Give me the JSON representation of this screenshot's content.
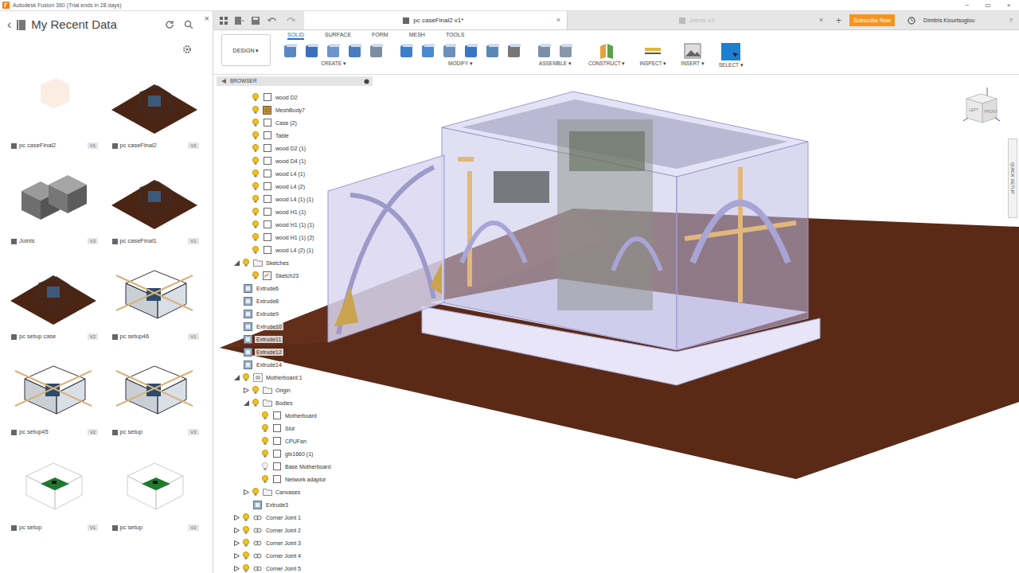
{
  "window": {
    "title": "Autodesk Fusion 360 (Trial ends in 28 days)",
    "controls": [
      "−",
      "▭",
      "×"
    ]
  },
  "data_panel": {
    "back": "‹",
    "title": "My Recent Data",
    "close": "×",
    "items": [
      {
        "name": "pc caseFinal2",
        "version": "V1",
        "kind": "blank"
      },
      {
        "name": "pc caseFinal2",
        "version": "V2",
        "kind": "floor"
      },
      {
        "name": "Joints",
        "version": "V3",
        "kind": "joints"
      },
      {
        "name": "pc caseFinal1",
        "version": "V1",
        "kind": "floor"
      },
      {
        "name": "pc setup case",
        "version": "V2",
        "kind": "floor"
      },
      {
        "name": "pc setup46",
        "version": "V1",
        "kind": "box"
      },
      {
        "name": "pc setup45",
        "version": "V2",
        "kind": "box"
      },
      {
        "name": "pc setup",
        "version": "V3",
        "kind": "box"
      },
      {
        "name": "pc setup",
        "version": "V1",
        "kind": "board"
      },
      {
        "name": "pc setup",
        "version": "V2",
        "kind": "board"
      }
    ]
  },
  "document_tabs": [
    {
      "label": "pc caseFinal2 v1*",
      "selected": true,
      "close": "×"
    },
    {
      "label": "Joints v3",
      "selected": false,
      "close": "×"
    }
  ],
  "new_tab": "+",
  "subscribe": "Subscribe Now",
  "user": "Dimitris Kiourtsoglou",
  "help": "?",
  "workspace": "DESIGN ▾",
  "toolbar_tabs": [
    {
      "label": "SOLID",
      "selected": true
    },
    {
      "label": "SURFACE",
      "selected": false
    },
    {
      "label": "FORM",
      "selected": false
    },
    {
      "label": "MESH",
      "selected": false
    },
    {
      "label": "TOOLS",
      "selected": false
    }
  ],
  "toolbar_groups": [
    {
      "label": "CREATE ▾"
    },
    {
      "label": "MODIFY ▾"
    },
    {
      "label": "ASSEMBLE ▾"
    },
    {
      "label": "CONSTRUCT ▾"
    },
    {
      "label": "INSPECT ▾"
    },
    {
      "label": "INSERT ▾"
    },
    {
      "label": "SELECT ▾"
    }
  ],
  "browser": {
    "title": "BROWSER",
    "rows": [
      {
        "label": "wood D2",
        "level": 1,
        "kind": "body",
        "visible": true
      },
      {
        "label": "MeshBody7",
        "level": 1,
        "kind": "mesh",
        "visible": true
      },
      {
        "label": "Case (2)",
        "level": 1,
        "kind": "body",
        "visible": true
      },
      {
        "label": "Table",
        "level": 1,
        "kind": "body",
        "visible": true
      },
      {
        "label": "wood D2 (1)",
        "level": 1,
        "kind": "body",
        "visible": true
      },
      {
        "label": "wood D4 (1)",
        "level": 1,
        "kind": "body",
        "visible": true
      },
      {
        "label": "wood L4 (1)",
        "level": 1,
        "kind": "body",
        "visible": true
      },
      {
        "label": "wood L4 (2)",
        "level": 1,
        "kind": "body",
        "visible": true
      },
      {
        "label": "wood L4 (1) (1)",
        "level": 1,
        "kind": "body",
        "visible": true
      },
      {
        "label": "wood H1 (1)",
        "level": 1,
        "kind": "body",
        "visible": true
      },
      {
        "label": "wood H1 (1) (1)",
        "level": 1,
        "kind": "body",
        "visible": true
      },
      {
        "label": "wood H1 (1) (2)",
        "level": 1,
        "kind": "body",
        "visible": true
      },
      {
        "label": "wood L4 (2) (1)",
        "level": 1,
        "kind": "body",
        "visible": true
      },
      {
        "label": "Sketches",
        "level": 0,
        "kind": "folder",
        "visible": true,
        "expanded": true
      },
      {
        "label": "Sketch23",
        "level": 1,
        "kind": "sketch",
        "visible": true
      },
      {
        "label": "Extrude6",
        "level": 0,
        "kind": "feature"
      },
      {
        "label": "Extrude8",
        "level": 0,
        "kind": "feature"
      },
      {
        "label": "Extrude9",
        "level": 0,
        "kind": "feature"
      },
      {
        "label": "Extrude10",
        "level": 0,
        "kind": "feature"
      },
      {
        "label": "Extrude11",
        "level": 0,
        "kind": "feature"
      },
      {
        "label": "Extrude12",
        "level": 0,
        "kind": "feature"
      },
      {
        "label": "Extrude14",
        "level": 0,
        "kind": "feature"
      },
      {
        "label": "Motherboard:1",
        "level": 0,
        "kind": "component",
        "visible": true,
        "expanded": true
      },
      {
        "label": "Origin",
        "level": 1,
        "kind": "folder",
        "visible": true,
        "expanded": false
      },
      {
        "label": "Bodies",
        "level": 1,
        "kind": "folder",
        "visible": true,
        "expanded": true
      },
      {
        "label": "Motherboard",
        "level": 2,
        "kind": "body",
        "visible": true
      },
      {
        "label": "Slot",
        "level": 2,
        "kind": "body",
        "visible": true
      },
      {
        "label": "CPUFan",
        "level": 2,
        "kind": "body",
        "visible": true
      },
      {
        "label": "gtx1660 (1)",
        "level": 2,
        "kind": "body",
        "visible": true
      },
      {
        "label": "Base Motherboard",
        "level": 2,
        "kind": "body",
        "visible": false
      },
      {
        "label": "Network adaptor",
        "level": 2,
        "kind": "body",
        "visible": true
      },
      {
        "label": "Canvases",
        "level": 1,
        "kind": "folder",
        "visible": true,
        "expanded": false
      },
      {
        "label": "Extrude3",
        "level": 1,
        "kind": "feature"
      },
      {
        "label": "Corner Joint 1",
        "level": 0,
        "kind": "joint",
        "visible": true,
        "expanded": false
      },
      {
        "label": "Corner Joint 2",
        "level": 0,
        "kind": "joint",
        "visible": true,
        "expanded": false
      },
      {
        "label": "Corner Joint 3",
        "level": 0,
        "kind": "joint",
        "visible": true,
        "expanded": false
      },
      {
        "label": "Corner Joint 4",
        "level": 0,
        "kind": "joint",
        "visible": true,
        "expanded": false
      },
      {
        "label": "Corner Joint 5",
        "level": 0,
        "kind": "joint",
        "visible": true,
        "expanded": false
      }
    ]
  },
  "viewcube": {
    "left": "LEFT",
    "front": "FRONT"
  },
  "quick_setup": "QUICK SETUP"
}
